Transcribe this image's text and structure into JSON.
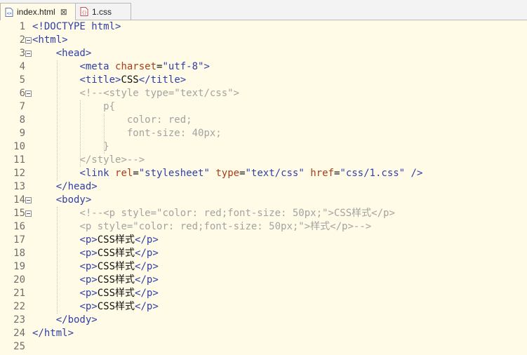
{
  "tabs": [
    {
      "label": "index.html",
      "close": "⊠",
      "active": true
    },
    {
      "label": "1.css",
      "active": false
    }
  ],
  "line_numbers": [
    "1",
    "2",
    "3",
    "4",
    "5",
    "6",
    "7",
    "8",
    "9",
    "10",
    "11",
    "12",
    "13",
    "14",
    "15",
    "16",
    "17",
    "18",
    "19",
    "20",
    "21",
    "22",
    "23",
    "24",
    "25"
  ],
  "colors": {
    "tag": "#2f3fa8",
    "attribute": "#a83b1a",
    "string": "#2f3fa8",
    "text": "#111111",
    "comment": "#a3a3a3",
    "background": "#fffbe6"
  },
  "code": [
    [
      [
        "<!DOCTYPE html>",
        "tg"
      ]
    ],
    [
      [
        "<html>",
        "tg"
      ]
    ],
    [
      [
        "<head>",
        "tg"
      ]
    ],
    [
      [
        "<meta ",
        "tg"
      ],
      [
        "charset",
        "at"
      ],
      [
        "=",
        "tx"
      ],
      [
        "\"utf-8\"",
        "st"
      ],
      [
        ">",
        "tg"
      ]
    ],
    [
      [
        "<title>",
        "tg"
      ],
      [
        "CSS",
        "tx"
      ],
      [
        "</title>",
        "tg"
      ]
    ],
    [
      [
        "<!--<style type=\"text/css\">",
        "cm"
      ]
    ],
    [
      [
        "p{",
        "cm"
      ]
    ],
    [
      [
        "color: red;",
        "cm"
      ]
    ],
    [
      [
        "font-size: 40px;",
        "cm"
      ]
    ],
    [
      [
        "}",
        "cm"
      ]
    ],
    [
      [
        "</style>-->",
        "cm"
      ]
    ],
    [
      [
        "<link ",
        "tg"
      ],
      [
        "rel",
        "at"
      ],
      [
        "=",
        "tx"
      ],
      [
        "\"stylesheet\"",
        "st"
      ],
      [
        " ",
        "tx"
      ],
      [
        "type",
        "at"
      ],
      [
        "=",
        "tx"
      ],
      [
        "\"text/css\"",
        "st"
      ],
      [
        " ",
        "tx"
      ],
      [
        "href",
        "at"
      ],
      [
        "=",
        "tx"
      ],
      [
        "\"css/1.css\"",
        "st"
      ],
      [
        " />",
        "tg"
      ]
    ],
    [
      [
        "</head>",
        "tg"
      ]
    ],
    [
      [
        "<body>",
        "tg"
      ]
    ],
    [
      [
        "<!--<p style=\"color: red;font-size: 50px;\">CSS样式</p>",
        "cm"
      ]
    ],
    [
      [
        "<p style=\"color: red;font-size: 50px;\">样式</p>-->",
        "cm"
      ]
    ],
    [
      [
        "<p>",
        "tg"
      ],
      [
        "CSS样式",
        "tx"
      ],
      [
        "</p>",
        "tg"
      ]
    ],
    [
      [
        "<p>",
        "tg"
      ],
      [
        "CSS样式",
        "tx"
      ],
      [
        "</p>",
        "tg"
      ]
    ],
    [
      [
        "<p>",
        "tg"
      ],
      [
        "CSS样式",
        "tx"
      ],
      [
        "</p>",
        "tg"
      ]
    ],
    [
      [
        "<p>",
        "tg"
      ],
      [
        "CSS样式",
        "tx"
      ],
      [
        "</p>",
        "tg"
      ]
    ],
    [
      [
        "<p>",
        "tg"
      ],
      [
        "CSS样式",
        "tx"
      ],
      [
        "</p>",
        "tg"
      ]
    ],
    [
      [
        "<p>",
        "tg"
      ],
      [
        "CSS样式",
        "tx"
      ],
      [
        "</p>",
        "tg"
      ]
    ],
    [
      [
        "</body>",
        "tg"
      ]
    ],
    [
      [
        "</html>",
        "tg"
      ]
    ],
    []
  ]
}
